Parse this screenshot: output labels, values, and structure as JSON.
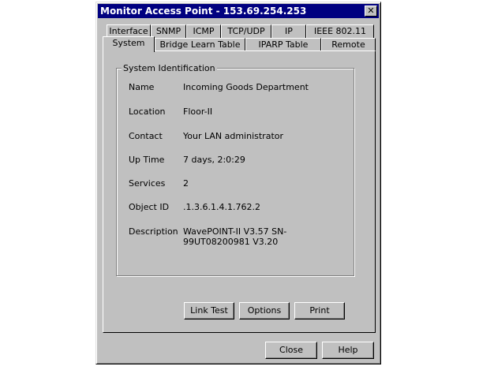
{
  "window": {
    "title": "Monitor Access Point - 153.69.254.253",
    "close_glyph": "✕"
  },
  "tabs": {
    "row1": [
      "Interface",
      "SNMP",
      "ICMP",
      "TCP/UDP",
      "IP",
      "IEEE 802.11"
    ],
    "row2": [
      "System",
      "Bridge Learn Table",
      "IPARP Table",
      "Remote"
    ],
    "active": "System"
  },
  "group": {
    "title": "System Identification",
    "fields": [
      {
        "label": "Name",
        "value": "Incoming Goods Department"
      },
      {
        "label": "Location",
        "value": "Floor-II"
      },
      {
        "label": "Contact",
        "value": "Your LAN administrator"
      },
      {
        "label": "Up Time",
        "value": "7 days, 2:0:29"
      },
      {
        "label": "Services",
        "value": "2"
      },
      {
        "label": "Object ID",
        "value": ".1.3.6.1.4.1.762.2"
      },
      {
        "label": "Description",
        "value": "WavePOINT-II V3.57 SN-99UT08200981 V3.20"
      }
    ]
  },
  "buttons": {
    "link_test": "Link Test",
    "options": "Options",
    "print": "Print",
    "close": "Close",
    "help": "Help"
  }
}
